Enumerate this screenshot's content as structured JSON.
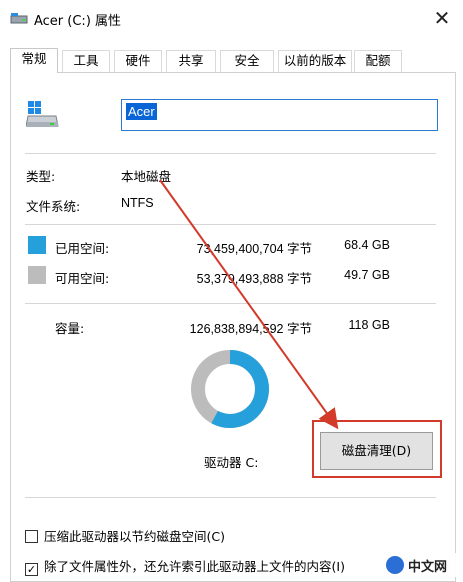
{
  "window": {
    "title": "Acer (C:) 属性",
    "close_glyph": "✕"
  },
  "tabs": [
    {
      "label": "常规",
      "active": true
    },
    {
      "label": "工具"
    },
    {
      "label": "硬件"
    },
    {
      "label": "共享"
    },
    {
      "label": "安全"
    },
    {
      "label": "以前的版本"
    },
    {
      "label": "配额"
    }
  ],
  "drive": {
    "name": "Acer",
    "icon": "drive-icon"
  },
  "info": {
    "type_label": "类型:",
    "type_value": "本地磁盘",
    "fs_label": "文件系统:",
    "fs_value": "NTFS"
  },
  "usage": {
    "used": {
      "label": "已用空间:",
      "bytes": "73,459,400,704 字节",
      "size": "68.4 GB",
      "color": "#26a0da"
    },
    "free": {
      "label": "可用空间:",
      "bytes": "53,379,493,888 字节",
      "size": "49.7 GB",
      "color": "#bcbcbc"
    },
    "capacity": {
      "label": "容量:",
      "bytes": "126,838,894,592 字节",
      "size": "118 GB"
    },
    "used_fraction": 0.579
  },
  "drive_label": "驱动器 C:",
  "cleanup_button": "磁盘清理(D)",
  "options": {
    "compress": {
      "label": "压缩此驱动器以节约磁盘空间(C)",
      "checked": false
    },
    "index": {
      "label": "除了文件属性外，还允许索引此驱动器上文件的内容(I)",
      "checked": true
    }
  },
  "watermark": {
    "text": "中文网"
  },
  "colors": {
    "accent": "#0a66d6",
    "annotation": "#d23a2a"
  }
}
